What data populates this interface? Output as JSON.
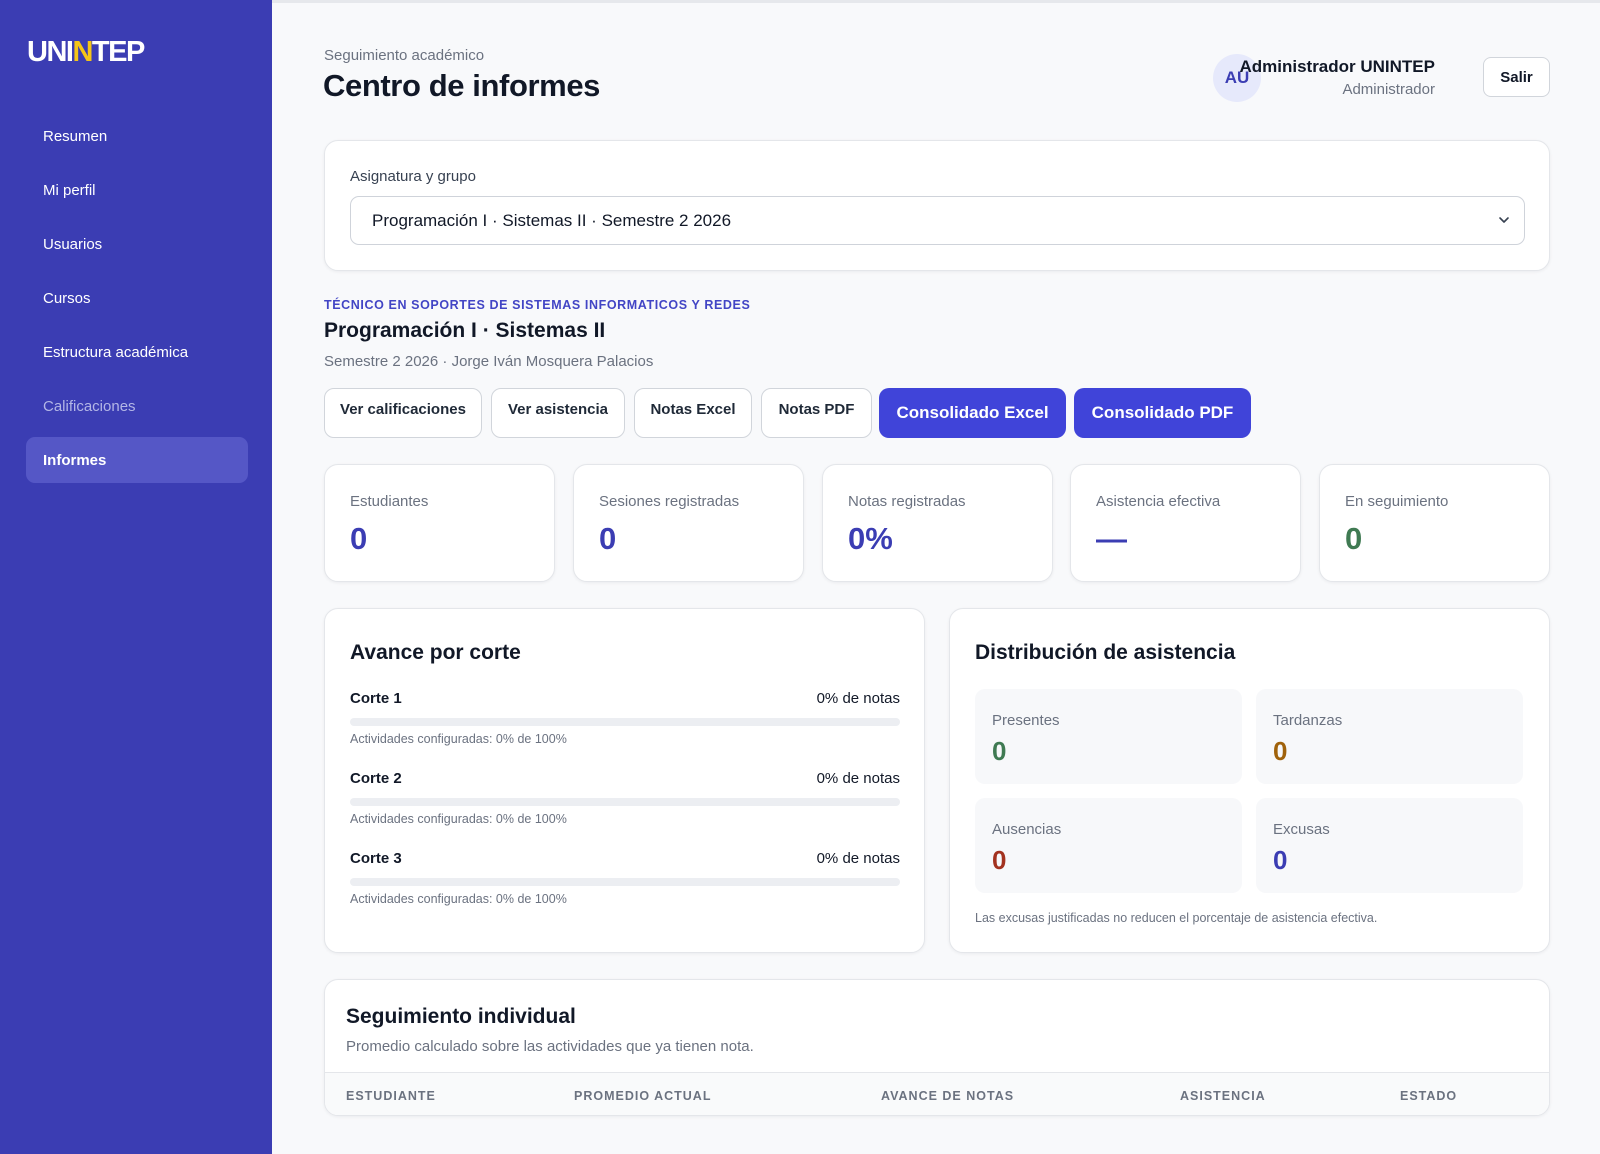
{
  "brand": {
    "pre": "UNI",
    "accent": "N",
    "post": "TEP"
  },
  "sidebar": {
    "items": [
      {
        "label": "Resumen"
      },
      {
        "label": "Mi perfil"
      },
      {
        "label": "Usuarios"
      },
      {
        "label": "Cursos"
      },
      {
        "label": "Estructura académica"
      },
      {
        "label": "Calificaciones"
      },
      {
        "label": "Informes"
      }
    ]
  },
  "header": {
    "eyebrow": "Seguimiento académico",
    "title": "Centro de informes",
    "user": {
      "initials": "AU",
      "name": "Administrador UNINTEP",
      "role": "Administrador"
    },
    "logout_label": "Salir"
  },
  "selector": {
    "label": "Asignatura y grupo",
    "value": "Programación I · Sistemas II · Semestre 2 2026"
  },
  "course": {
    "program": "TÉCNICO EN SOPORTES DE SISTEMAS INFORMATICOS Y REDES",
    "title": "Programación I · Sistemas II",
    "subtitle": "Semestre 2 2026 · Jorge Iván Mosquera Palacios"
  },
  "actions": {
    "ver_calificaciones": "Ver calificaciones",
    "ver_asistencia": "Ver asistencia",
    "notas_excel": "Notas Excel",
    "notas_pdf": "Notas PDF",
    "consolidado_excel": "Consolidado Excel",
    "consolidado_pdf": "Consolidado PDF"
  },
  "stats": [
    {
      "label": "Estudiantes",
      "value": "0",
      "color": "#3b3db3"
    },
    {
      "label": "Sesiones registradas",
      "value": "0",
      "color": "#3b3db3"
    },
    {
      "label": "Notas registradas",
      "value": "0%",
      "color": "#3b3db3"
    },
    {
      "label": "Asistencia efectiva",
      "value": "—",
      "color": "#3b3db3"
    },
    {
      "label": "En seguimiento",
      "value": "0",
      "color": "#3f7a52"
    }
  ],
  "progress": {
    "title": "Avance por corte",
    "cortes": [
      {
        "name": "Corte 1",
        "pct_label": "0% de notas",
        "progress": 0,
        "note": "Actividades configuradas: 0% de 100%"
      },
      {
        "name": "Corte 2",
        "pct_label": "0% de notas",
        "progress": 0,
        "note": "Actividades configuradas: 0% de 100%"
      },
      {
        "name": "Corte 3",
        "pct_label": "0% de notas",
        "progress": 0,
        "note": "Actividades configuradas: 0% de 100%"
      }
    ]
  },
  "attendance": {
    "title": "Distribución de asistencia",
    "boxes": [
      {
        "label": "Presentes",
        "value": "0",
        "color": "#3f7a52"
      },
      {
        "label": "Tardanzas",
        "value": "0",
        "color": "#a0620b"
      },
      {
        "label": "Ausencias",
        "value": "0",
        "color": "#a3321f"
      },
      {
        "label": "Excusas",
        "value": "0",
        "color": "#3b3db3"
      }
    ],
    "note": "Las excusas justificadas no reducen el porcentaje de asistencia efectiva."
  },
  "tracking": {
    "title": "Seguimiento individual",
    "subtitle": "Promedio calculado sobre las actividades que ya tienen nota.",
    "columns": [
      "ESTUDIANTE",
      "PROMEDIO ACTUAL",
      "AVANCE DE NOTAS",
      "ASISTENCIA",
      "ESTADO"
    ]
  },
  "colors": {
    "sidebar": "#3b3db3",
    "primary": "#4044d9",
    "accent": "#f5c518"
  }
}
